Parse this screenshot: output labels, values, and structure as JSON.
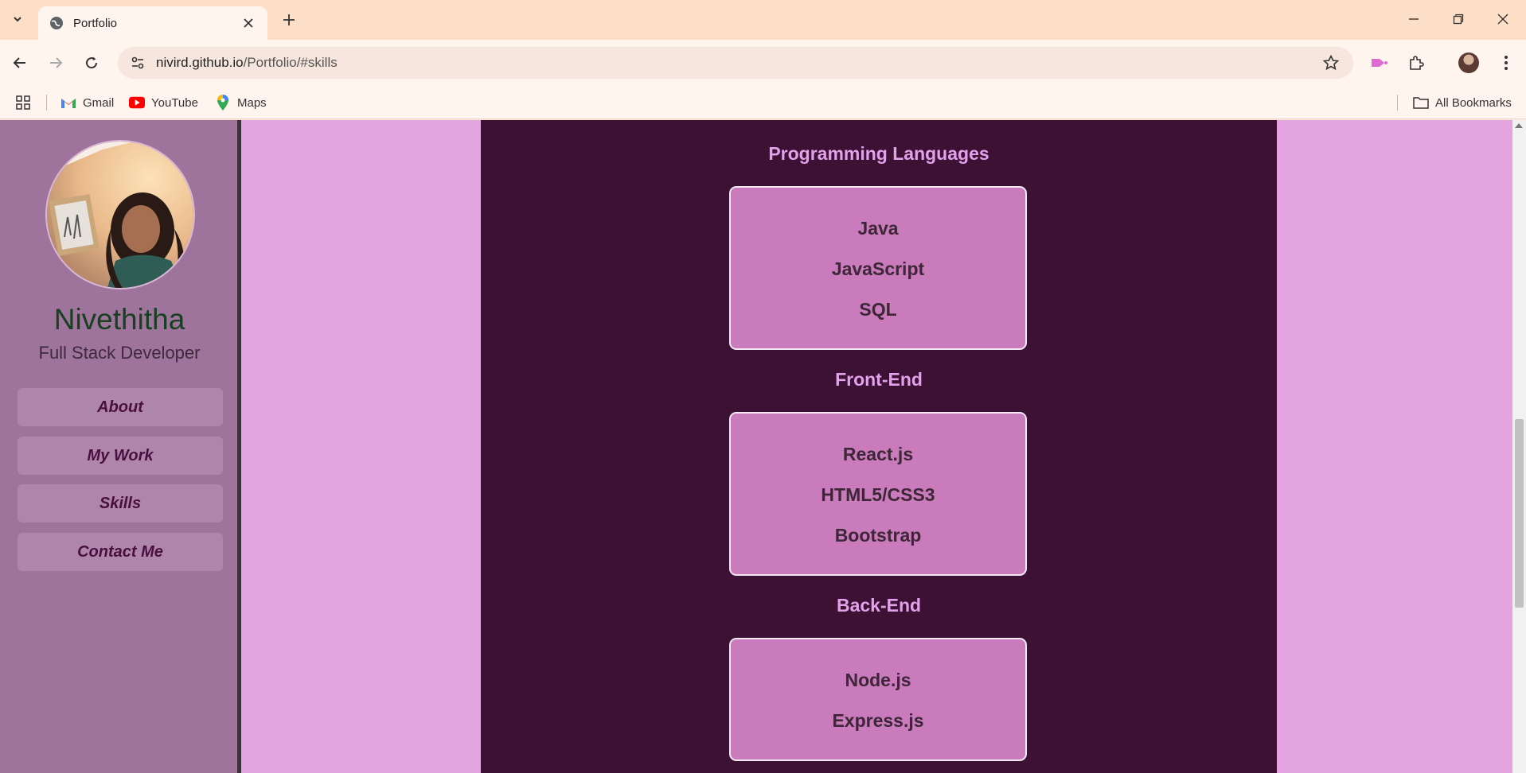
{
  "browser": {
    "tab_title": "Portfolio",
    "url_host": "nivird.github.io",
    "url_path": "/Portfolio/#skills",
    "bookmarks": [
      "Gmail",
      "YouTube",
      "Maps"
    ],
    "all_bookmarks": "All Bookmarks"
  },
  "sidebar": {
    "name": "Nivethitha",
    "role": "Full Stack Developer",
    "nav": [
      "About",
      "My Work",
      "Skills",
      "Contact Me"
    ]
  },
  "skills": {
    "sections": [
      {
        "title": "Programming Languages",
        "items": [
          "Java",
          "JavaScript",
          "SQL"
        ]
      },
      {
        "title": "Front-End",
        "items": [
          "React.js",
          "HTML5/CSS3",
          "Bootstrap"
        ]
      },
      {
        "title": "Back-End",
        "items": [
          "Node.js",
          "Express.js"
        ]
      }
    ]
  },
  "colors": {
    "page_bg": "#e3a4df",
    "sidebar_bg": "#9e739c",
    "content_bg": "#3c1133",
    "card_bg": "#c97bbc",
    "section_title": "#e2a1eb"
  }
}
